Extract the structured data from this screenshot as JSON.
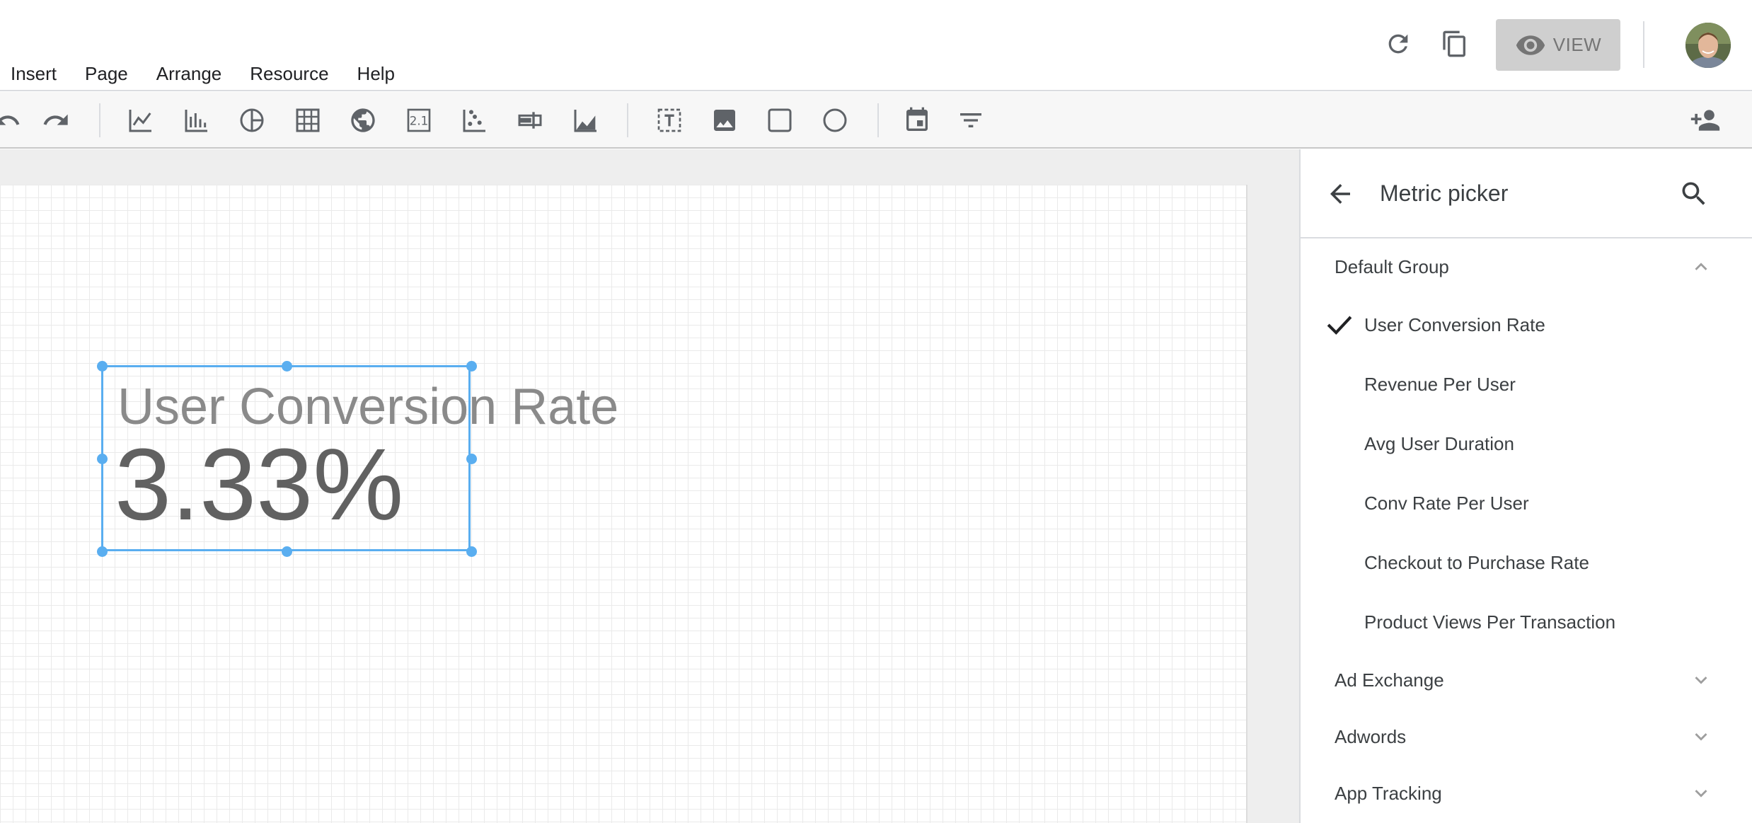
{
  "menu": [
    "Insert",
    "Page",
    "Arrange",
    "Resource",
    "Help"
  ],
  "header": {
    "view_label": "VIEW"
  },
  "scorecard": {
    "title": "User Conversion Rate",
    "value": "3.33%"
  },
  "panel": {
    "title": "Metric picker",
    "default_group": "Default Group",
    "metrics": [
      "User Conversion Rate",
      "Revenue Per User",
      "Avg User Duration",
      "Conv Rate Per User",
      "Checkout to Purchase Rate",
      "Product Views Per Transaction"
    ],
    "selected_metric": "User Conversion Rate",
    "collapsed_groups": [
      "Ad Exchange",
      "Adwords",
      "App Tracking"
    ]
  },
  "colors": {
    "accent": "#5aaef0",
    "icon": "#5f6368",
    "view_button_bg": "#cfcfcf"
  },
  "icons": {
    "header": [
      "refresh-icon",
      "copy-icon",
      "eye-icon"
    ],
    "toolbar": [
      "undo-icon",
      "redo-icon",
      "time-series-chart-icon",
      "bar-chart-icon",
      "pie-chart-icon",
      "table-icon",
      "geo-map-icon",
      "scorecard-icon",
      "scatter-chart-icon",
      "bullet-chart-icon",
      "area-chart-icon",
      "text-icon",
      "image-icon",
      "rectangle-icon",
      "circle-icon",
      "date-range-icon",
      "filter-control-icon",
      "add-person-icon"
    ]
  }
}
